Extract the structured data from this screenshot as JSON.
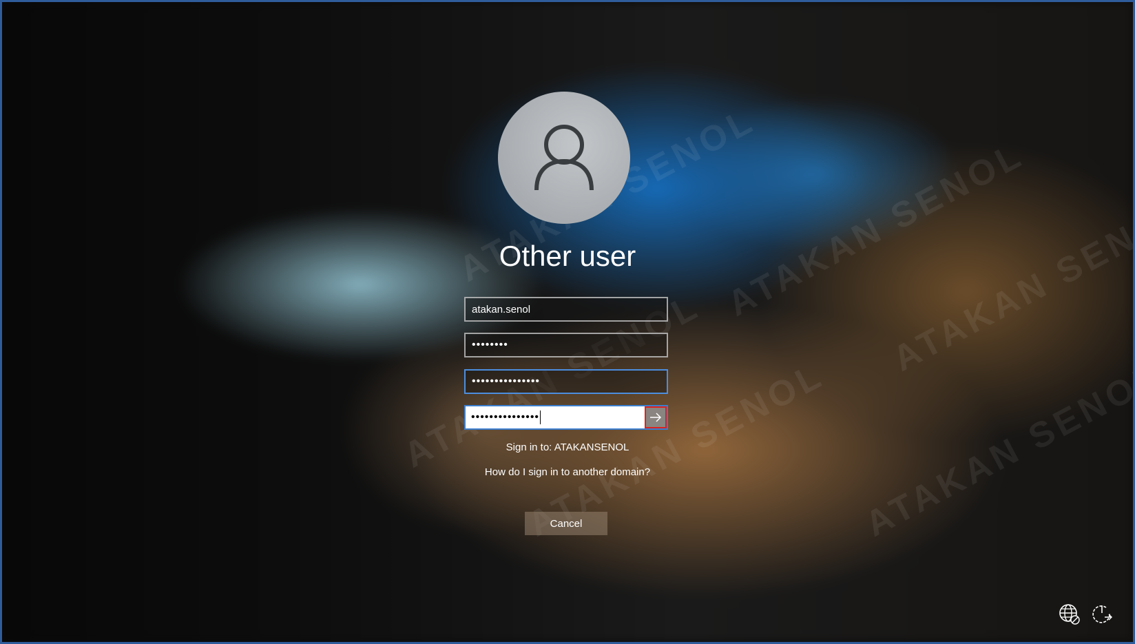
{
  "user": {
    "title": "Other user",
    "avatar_icon": "user-icon"
  },
  "form": {
    "username_value": "atakan.senol",
    "current_password_value": "••••••••",
    "new_password_value": "•••••••••••••••",
    "confirm_password_value": "•••••••••••••••",
    "submit_icon": "arrow-right-icon"
  },
  "info": {
    "sign_in_to": "Sign in to: ATAKANSENOL",
    "other_domain_link": "How do I sign in to another domain?"
  },
  "actions": {
    "cancel_label": "Cancel"
  },
  "watermark": {
    "text": "ATAKAN SENOL"
  },
  "system_icons": {
    "network": "network-globe-icon",
    "power": "power-restart-icon"
  },
  "colors": {
    "focus_border": "#3b7fd0",
    "submit_highlight": "#e0201c"
  }
}
